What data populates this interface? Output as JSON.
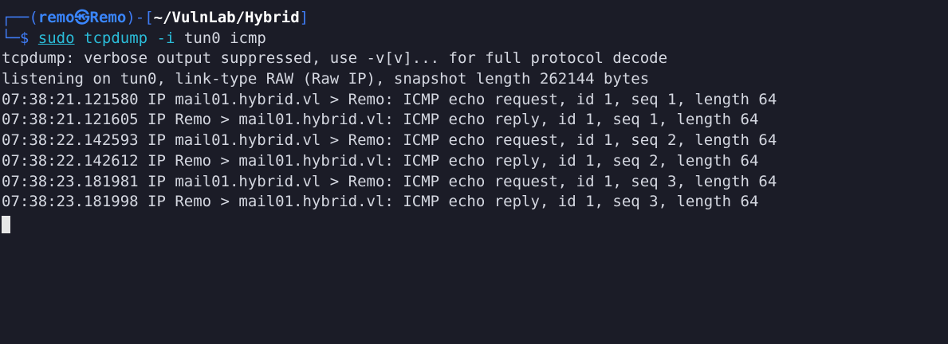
{
  "prompt": {
    "box_top": "┌──(",
    "user": "remo",
    "skull": "㉿",
    "host": "Remo",
    "mid": ")-[",
    "cwd": "~/VulnLab/Hybrid",
    "close": "]",
    "box_bottom": "└─",
    "symbol": "$",
    "cmd_sudo": "sudo",
    "cmd_name": "tcpdump",
    "cmd_flag": "-i",
    "cmd_args": "tun0 icmp"
  },
  "output": [
    "tcpdump: verbose output suppressed, use -v[v]... for full protocol decode",
    "listening on tun0, link-type RAW (Raw IP), snapshot length 262144 bytes",
    "07:38:21.121580 IP mail01.hybrid.vl > Remo: ICMP echo request, id 1, seq 1, length 64",
    "07:38:21.121605 IP Remo > mail01.hybrid.vl: ICMP echo reply, id 1, seq 1, length 64",
    "07:38:22.142593 IP mail01.hybrid.vl > Remo: ICMP echo request, id 1, seq 2, length 64",
    "07:38:22.142612 IP Remo > mail01.hybrid.vl: ICMP echo reply, id 1, seq 2, length 64",
    "07:38:23.181981 IP mail01.hybrid.vl > Remo: ICMP echo request, id 1, seq 3, length 64",
    "07:38:23.181998 IP Remo > mail01.hybrid.vl: ICMP echo reply, id 1, seq 3, length 64"
  ],
  "colors": {
    "background": "#1b1c27",
    "prompt_blue": "#3f7cf5",
    "command_cyan": "#2bbcd8",
    "text": "#d4d7e0"
  }
}
